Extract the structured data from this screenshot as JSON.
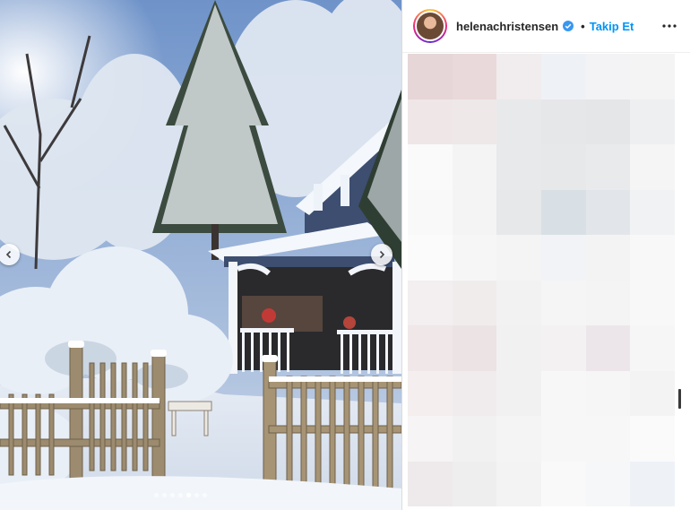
{
  "post": {
    "username": "helenachristensen",
    "separator": "•",
    "follow_label": "Takip Et",
    "verified": true,
    "more_icon": "more-horizontal-icon",
    "carousel": {
      "slide_count": 7,
      "active_index": 4,
      "prev_icon": "chevron-left-icon",
      "next_icon": "chevron-right-icon"
    }
  },
  "colors": {
    "link": "#0095f6",
    "text": "#262626",
    "border": "#dbdbdb"
  },
  "comments": {
    "pixelated": true
  }
}
